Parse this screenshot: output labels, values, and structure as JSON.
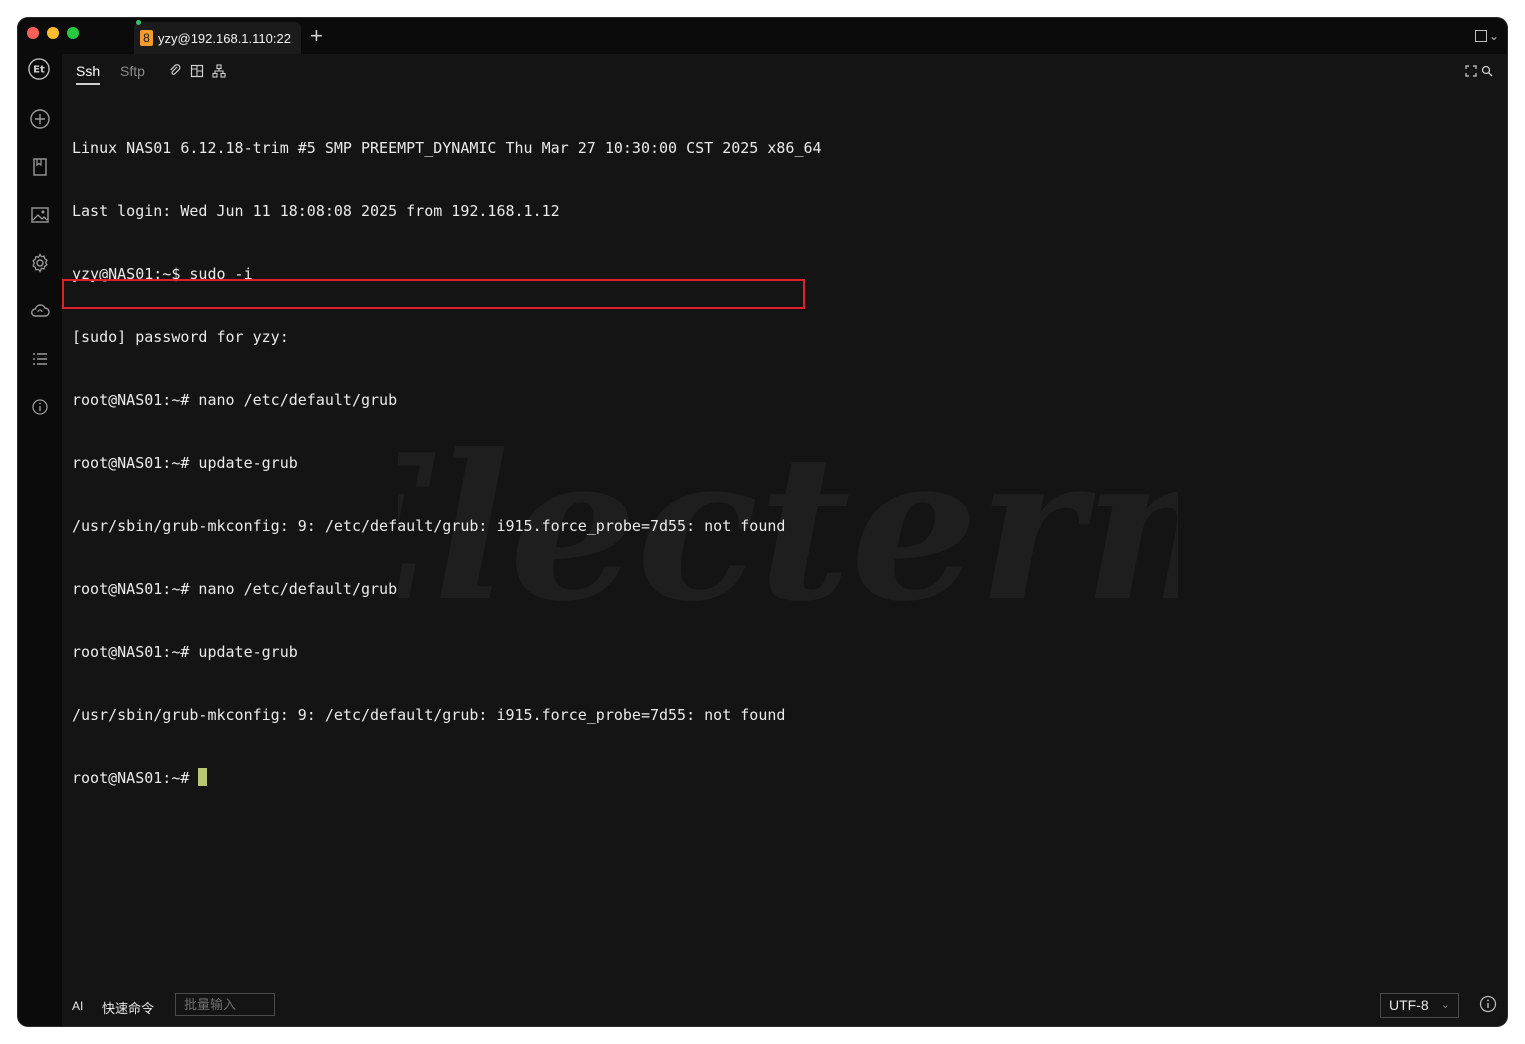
{
  "window": {
    "tab": {
      "badge": "8",
      "title": "yzy@192.168.1.110:22"
    },
    "add_tab_symbol": "+"
  },
  "subtabs": {
    "ssh": "Ssh",
    "sftp": "Sftp"
  },
  "sidebar": {
    "icons": [
      "electerm-logo-icon",
      "add-circle-icon",
      "bookmark-icon",
      "image-icon",
      "gear-icon",
      "cloud-sync-icon",
      "list-icon",
      "info-icon"
    ]
  },
  "terminal": {
    "lines": [
      "Linux NAS01 6.12.18-trim #5 SMP PREEMPT_DYNAMIC Thu Mar 27 10:30:00 CST 2025 x86_64",
      "Last login: Wed Jun 11 18:08:08 2025 from 192.168.1.12",
      "yzy@NAS01:~$ sudo -i",
      "[sudo] password for yzy:",
      "root@NAS01:~# nano /etc/default/grub",
      "root@NAS01:~# update-grub",
      "/usr/sbin/grub-mkconfig: 9: /etc/default/grub: i915.force_probe=7d55: not found",
      "root@NAS01:~# nano /etc/default/grub",
      "root@NAS01:~# update-grub",
      "/usr/sbin/grub-mkconfig: 9: /etc/default/grub: i915.force_probe=7d55: not found",
      "root@NAS01:~# "
    ],
    "watermark": "Electerm",
    "highlight_color": "#e0202c",
    "cursor_color": "#b7c86e"
  },
  "footer": {
    "ai_label": "AI",
    "quick_command": "快速命令",
    "batch_input_placeholder": "批量输入",
    "encoding": "UTF-8"
  }
}
